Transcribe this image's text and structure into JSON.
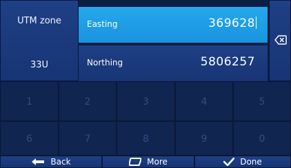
{
  "utm": {
    "label": "UTM zone",
    "value": "33U"
  },
  "easting": {
    "label": "Easting",
    "value": "369628"
  },
  "northing": {
    "label": "Northing",
    "value": "5806257"
  },
  "keypad": [
    "1",
    "2",
    "3",
    "4",
    "5",
    "6",
    "7",
    "8",
    "9",
    "0"
  ],
  "bottom": {
    "back": "Back",
    "more": "More",
    "done": "Done"
  },
  "colors": {
    "accent": "#24a8ee",
    "panel": "#1f3f86",
    "key": "#10254f",
    "disabled_text": "#2f4f86"
  }
}
